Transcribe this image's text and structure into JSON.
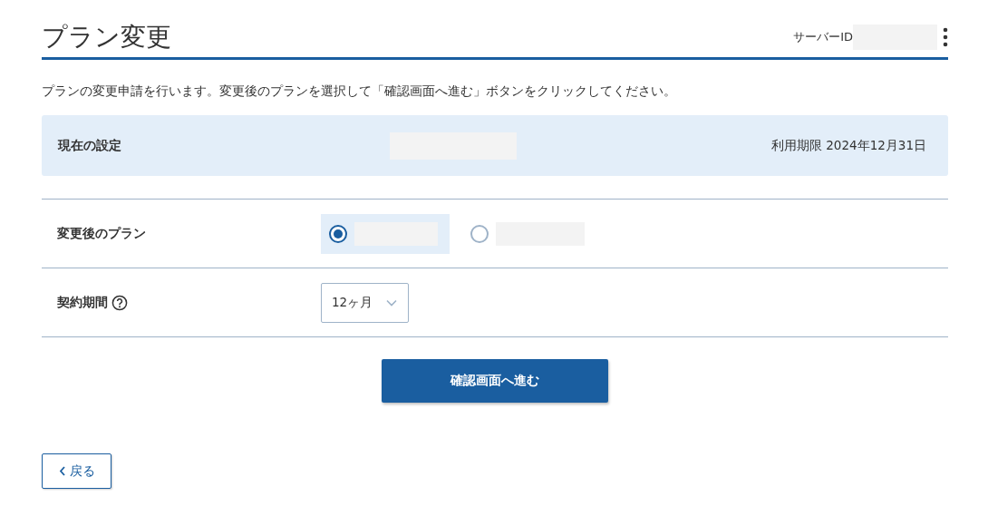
{
  "header": {
    "title": "プラン変更",
    "server_id_label": "サーバーID"
  },
  "description": "プランの変更申請を行います。変更後のプランを選択して「確認画面へ進む」ボタンをクリックしてください。",
  "current": {
    "label": "現在の設定",
    "expiry": "利用期限 2024年12月31日"
  },
  "form": {
    "plan_label": "変更後のプラン",
    "plan_options": [
      {
        "selected": true
      },
      {
        "selected": false
      }
    ],
    "term_label": "契約期間",
    "term_value": "12ヶ月"
  },
  "confirm_button": "確認画面へ進む",
  "back_button": "戻る"
}
